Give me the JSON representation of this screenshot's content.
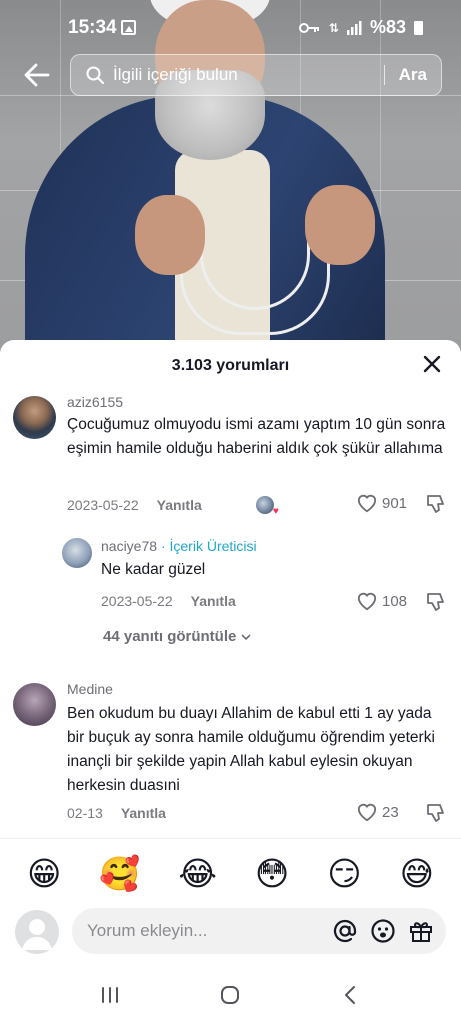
{
  "status_bar": {
    "time": "15:34",
    "battery": "%83"
  },
  "search": {
    "placeholder": "İlgili içeriği bulun",
    "button": "Ara"
  },
  "comments_sheet": {
    "title": "3.103 yorumları",
    "comments": [
      {
        "username": "aziz6155",
        "text": "Çocuğumuz olmuyodu ismi azamı yaptım 10 gün sonra eşimin hamile olduğu haberini aldık çok şükür allahıma",
        "date": "2023-05-22",
        "reply_label": "Yanıtla",
        "likes": "901"
      },
      {
        "username": "naciye78",
        "badge": "· İçerik Üreticisi",
        "text": "Ne kadar güzel",
        "date": "2023-05-22",
        "reply_label": "Yanıtla",
        "likes": "108"
      },
      {
        "username": "Medine",
        "text": "Ben okudum bu duayı Allahim de kabul etti 1 ay yada bir buçuk ay sonra hamile olduğumu öğrendim yeterki inançli bir şekilde yapin Allah kabul eylesin okuyan herkesin duasıni",
        "date": "02-13",
        "reply_label": "Yanıtla",
        "likes": "23"
      }
    ],
    "view_replies": "44 yanıtı görüntüle"
  },
  "emoji_bar": [
    "😁",
    "🥰",
    "😂",
    "😳",
    "😏",
    "😅"
  ],
  "comment_input": {
    "placeholder": "Yorum ekleyin..."
  }
}
